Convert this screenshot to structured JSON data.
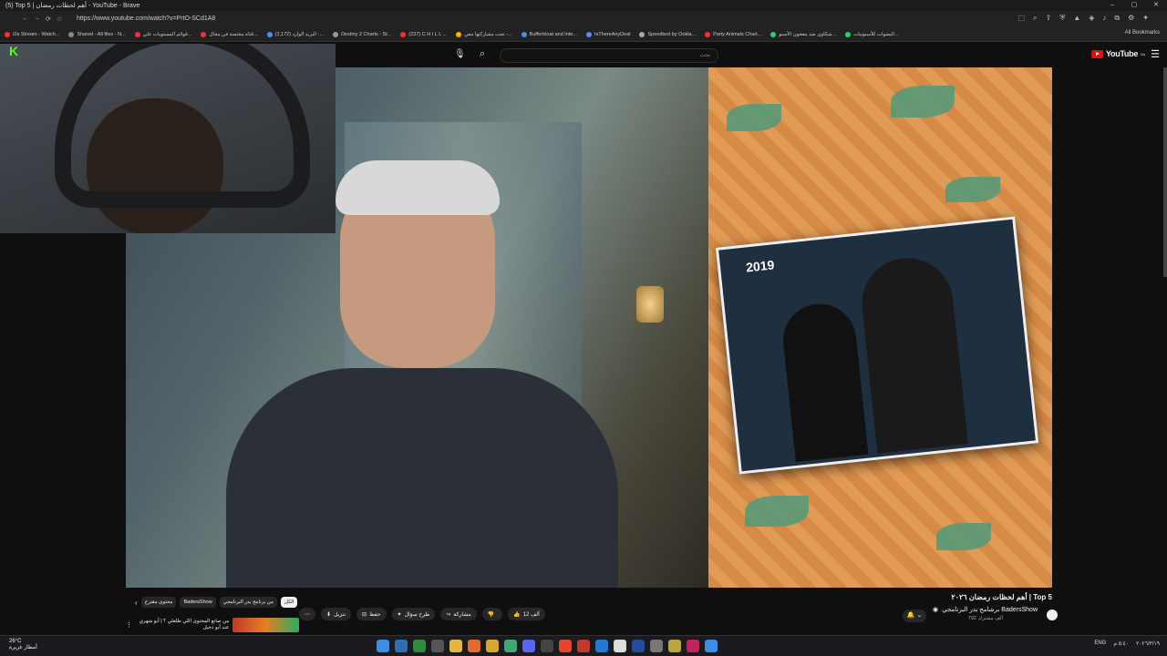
{
  "window": {
    "title": "(5) Top 5 | أهم لحظات رمضان - YouTube - Brave",
    "controls": [
      "–",
      "▢",
      "✕"
    ]
  },
  "browser": {
    "url": "https://www.youtube.com/watch?v=PrtO-SCd1A8",
    "nav": [
      "←",
      "→",
      "⟳",
      "☆"
    ],
    "extensions": [
      "⬚",
      "⌕",
      "⇪",
      "⛨",
      "▲",
      "◈",
      "♪",
      "⧉",
      "⚙",
      "✦"
    ],
    "bookmarks": [
      "i2a Stream - Watch...",
      "Shared - All files - N...",
      "قوائم المستويات علي...",
      "قناة مختصة في مجال...",
      "(1,172) البريد الوارد -...",
      "Destiny 2 Charts - St...",
      "(237) C H I L L ...",
      "تحت مشاركتها معي -...",
      "Bufferbloat and Inte...",
      "IsThereAnyDeal",
      "Speedtest by Ookla...",
      "Party Animals Chart...",
      "شكاوى ضد معجون الأسنو...",
      "البضوات للأسنونيات..."
    ],
    "all_bookmarks": "All Bookmarks"
  },
  "youtube": {
    "search_placeholder": "بحث",
    "logo_text": "YouTube",
    "logo_sup": "SA"
  },
  "webcam": {
    "overlay": "K"
  },
  "video": {
    "thumbnail_year": "2019",
    "title": "Top 5 | أهم لحظات رمضان ٢٠٢٦",
    "channel": "برشامج بدر البرنامجي BadersShow",
    "subscribers": "792 ألف مشترك",
    "bell": "🔔 ⌄",
    "actions": {
      "like": "12 ألف",
      "dislike": "",
      "share": "مشاركة",
      "ask": "طرح سؤال",
      "save": "حفظ",
      "download": "تنزيل",
      "more": "⋯"
    },
    "chips": [
      "الكل",
      "من برنامج بدر البرنامجي",
      "BadersShow",
      "محتوى مقترح"
    ],
    "next_title": "من صانع المحتوى اللي طلعلي ؟ | أبو شهري عند أبو دجيل"
  },
  "taskbar": {
    "weather_temp": "26°C",
    "weather_desc": "أمطار غزيرة",
    "lang": "ENG",
    "time": "٥:٤٠ م",
    "date": "٢٠٢٦/٣/١٩"
  }
}
